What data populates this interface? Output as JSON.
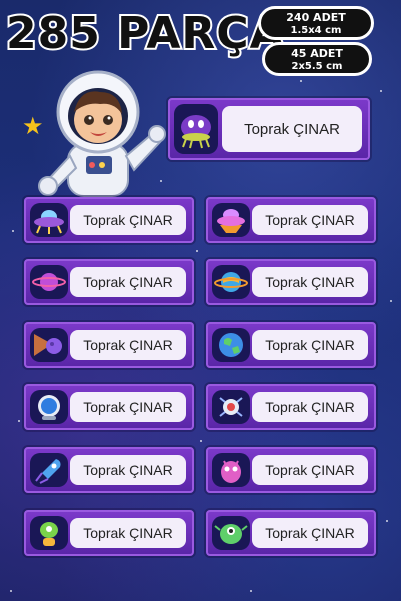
{
  "header": {
    "title": "285 PARÇA",
    "pill1": {
      "count": "240 ADET",
      "size": "1.5x4 cm"
    },
    "pill2": {
      "count": "45 ADET",
      "size": "2x5.5 cm"
    }
  },
  "big_label": {
    "name": "Toprak ÇINAR",
    "icon": "alien-ufo-icon"
  },
  "labels": [
    {
      "name": "Toprak ÇINAR",
      "icon": "ufo-icon"
    },
    {
      "name": "Toprak ÇINAR",
      "icon": "ufo-orange-icon"
    },
    {
      "name": "Toprak ÇINAR",
      "icon": "saturn-planet-icon"
    },
    {
      "name": "Toprak ÇINAR",
      "icon": "ringed-planet-icon"
    },
    {
      "name": "Toprak ÇINAR",
      "icon": "comet-icon"
    },
    {
      "name": "Toprak ÇINAR",
      "icon": "earth-icon"
    },
    {
      "name": "Toprak ÇINAR",
      "icon": "space-helmet-icon"
    },
    {
      "name": "Toprak ÇINAR",
      "icon": "satellite-icon"
    },
    {
      "name": "Toprak ÇINAR",
      "icon": "rocket-icon"
    },
    {
      "name": "Toprak ÇINAR",
      "icon": "pink-alien-icon"
    },
    {
      "name": "Toprak ÇINAR",
      "icon": "green-alien-icon"
    },
    {
      "name": "Toprak ÇINAR",
      "icon": "alien-monster-icon"
    }
  ],
  "colors": {
    "label_purple": "#6a2fb8",
    "field_bg": "#f3eefa",
    "icon_bg": "#1a1756",
    "background": "#1c2f7a"
  }
}
